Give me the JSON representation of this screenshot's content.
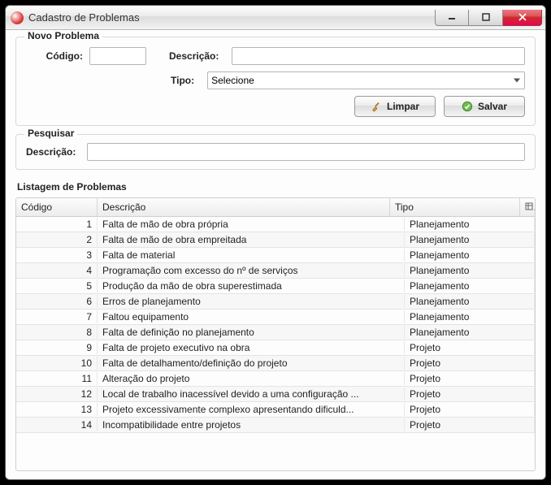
{
  "window": {
    "title": "Cadastro de Problemas"
  },
  "novo": {
    "legend": "Novo Problema",
    "codigo_label": "Código:",
    "codigo_value": "",
    "descricao_label": "Descrição:",
    "descricao_value": "",
    "tipo_label": "Tipo:",
    "tipo_selected": "Selecione",
    "btn_limpar": "Limpar",
    "btn_salvar": "Salvar"
  },
  "pesquisar": {
    "legend": "Pesquisar",
    "descricao_label": "Descrição:",
    "descricao_value": ""
  },
  "listagem": {
    "title": "Listagem de Problemas",
    "col_codigo": "Código",
    "col_descricao": "Descrição",
    "col_tipo": "Tipo",
    "rows": [
      {
        "codigo": "1",
        "descricao": "Falta de mão de obra própria",
        "tipo": "Planejamento"
      },
      {
        "codigo": "2",
        "descricao": "Falta de mão de obra empreitada",
        "tipo": "Planejamento"
      },
      {
        "codigo": "3",
        "descricao": "Falta de material",
        "tipo": "Planejamento"
      },
      {
        "codigo": "4",
        "descricao": "Programação com excesso do nº de serviços",
        "tipo": "Planejamento"
      },
      {
        "codigo": "5",
        "descricao": "Produção da mão de obra superestimada",
        "tipo": "Planejamento"
      },
      {
        "codigo": "6",
        "descricao": "Erros de planejamento",
        "tipo": "Planejamento"
      },
      {
        "codigo": "7",
        "descricao": "Faltou equipamento",
        "tipo": "Planejamento"
      },
      {
        "codigo": "8",
        "descricao": "Falta de definição no planejamento",
        "tipo": "Planejamento"
      },
      {
        "codigo": "9",
        "descricao": "Falta de projeto executivo na obra",
        "tipo": "Projeto"
      },
      {
        "codigo": "10",
        "descricao": "Falta de detalhamento/definição do projeto",
        "tipo": "Projeto"
      },
      {
        "codigo": "11",
        "descricao": "Alteração do projeto",
        "tipo": "Projeto"
      },
      {
        "codigo": "12",
        "descricao": "Local de trabalho inacessível devido a uma configuração ...",
        "tipo": "Projeto"
      },
      {
        "codigo": "13",
        "descricao": "Projeto excessivamente complexo apresentando dificuld...",
        "tipo": "Projeto"
      },
      {
        "codigo": "14",
        "descricao": "Incompatibilidade entre projetos",
        "tipo": "Projeto"
      }
    ]
  }
}
